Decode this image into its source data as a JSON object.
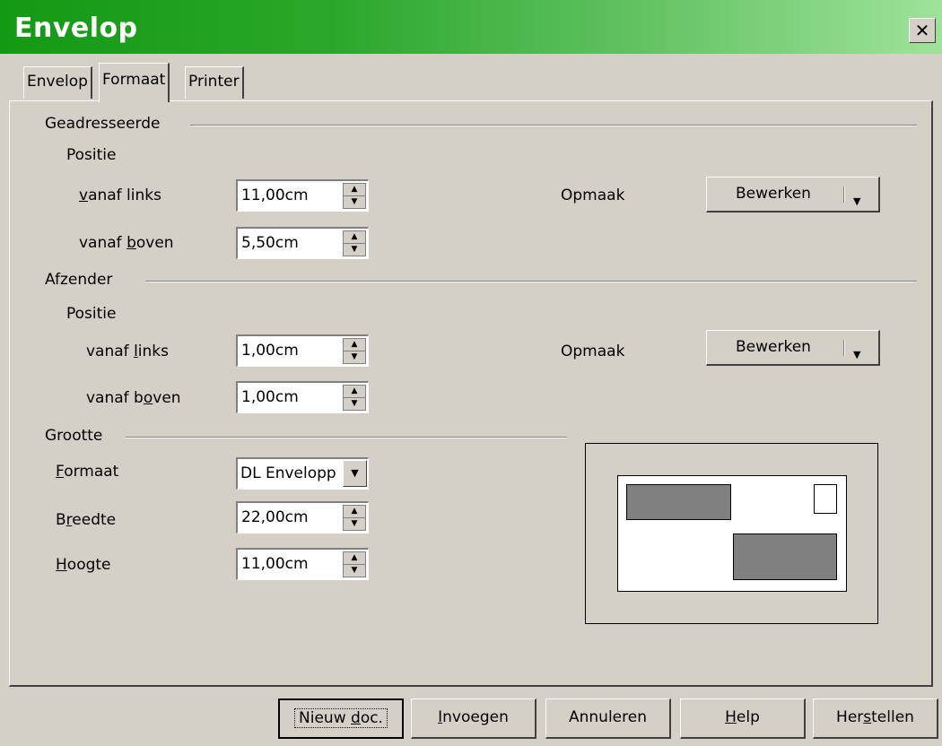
{
  "window": {
    "title": "Envelop",
    "close_symbol": "✕"
  },
  "tabs": [
    {
      "label": "Envelop",
      "active": false
    },
    {
      "label": "Formaat",
      "active": true
    },
    {
      "label": "Printer",
      "active": false
    }
  ],
  "addressee": {
    "section_label": "Geadresseerde",
    "position_label": "Positie",
    "left_label_parts": {
      "u": "v",
      "rest": "anaf links"
    },
    "left_value": "11,00cm",
    "top_label_parts": {
      "pre": "vanaf ",
      "u": "b",
      "rest": "oven"
    },
    "top_value": "5,50cm",
    "format_label": "Opmaak",
    "edit_button": "Bewerken"
  },
  "sender": {
    "section_label": "Afzender",
    "position_label": "Positie",
    "left_label_parts": {
      "pre": "vanaf ",
      "u": "l",
      "rest": "inks"
    },
    "left_value": "1,00cm",
    "top_label_parts": {
      "pre": "vanaf b",
      "u": "o",
      "rest": "ven"
    },
    "top_value": "1,00cm",
    "format_label": "Opmaak",
    "edit_button": "Bewerken"
  },
  "size": {
    "section_label": "Grootte",
    "format_label_parts": {
      "u": "F",
      "rest": "ormaat"
    },
    "format_value": "DL Envelopp",
    "width_label_parts": {
      "pre": "B",
      "u": "r",
      "rest": "eedte"
    },
    "width_value": "22,00cm",
    "height_label_parts": {
      "u": "H",
      "rest": "oogte"
    },
    "height_value": "11,00cm"
  },
  "footer": {
    "new_doc_parts": {
      "pre": "Nieuw ",
      "u": "d",
      "rest": "oc."
    },
    "insert_parts": {
      "u": "I",
      "rest": "nvoegen"
    },
    "cancel": "Annuleren",
    "help_parts": {
      "u": "H",
      "rest": "elp"
    },
    "reset_parts": {
      "pre": "Her",
      "u": "s",
      "rest": "tellen"
    }
  },
  "icons": {
    "spin_up": "▲",
    "spin_down": "▼",
    "dropdown": "▼"
  }
}
